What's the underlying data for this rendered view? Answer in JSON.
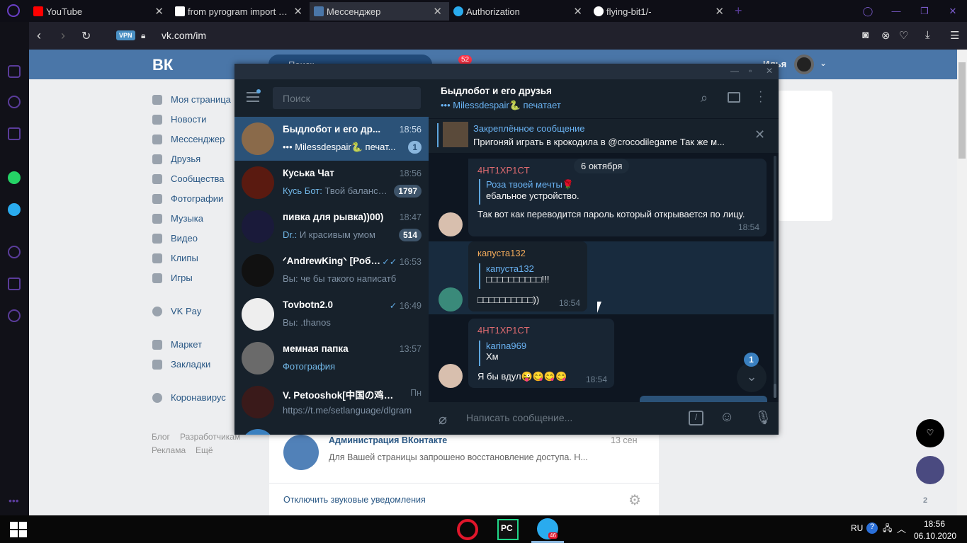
{
  "browser": {
    "tabs": [
      {
        "title": "YouTube",
        "favicon_color": "#ff0000"
      },
      {
        "title": "from pyrogram import Clie",
        "favicon_color": "#ffffff"
      },
      {
        "title": "Мессенджер",
        "favicon_color": "#4a76a8"
      },
      {
        "title": "Authorization",
        "favicon_color": "#2aabee"
      },
      {
        "title": "flying-bit1/-",
        "favicon_color": "#ffffff"
      }
    ],
    "vpn_label": "VPN",
    "url": "vk.com/im"
  },
  "vk": {
    "logo": "ВК",
    "search_placeholder": "Поиск",
    "notif_count": "52",
    "user_name": "Илья",
    "menu": [
      {
        "label": "Моя страница",
        "icon": "home-icon"
      },
      {
        "label": "Новости",
        "icon": "news-icon"
      },
      {
        "label": "Мессенджер",
        "icon": "messenger-icon"
      },
      {
        "label": "Друзья",
        "icon": "friends-icon"
      },
      {
        "label": "Сообщества",
        "icon": "groups-icon"
      },
      {
        "label": "Фотографии",
        "icon": "camera-icon"
      },
      {
        "label": "Музыка",
        "icon": "music-icon"
      },
      {
        "label": "Видео",
        "icon": "video-icon"
      },
      {
        "label": "Клипы",
        "icon": "clips-icon"
      },
      {
        "label": "Игры",
        "icon": "games-icon"
      },
      {
        "label": "VK Pay",
        "icon": "vkpay-icon"
      },
      {
        "label": "Маркет",
        "icon": "market-icon"
      },
      {
        "label": "Закладки",
        "icon": "star-icon"
      },
      {
        "label": "Коронавирус",
        "icon": "virus-icon"
      }
    ],
    "footer": [
      "Блог",
      "Разработчикам",
      "Реклама",
      "Ещё"
    ],
    "admin_dialog": {
      "name": "Администрация ВКонтакте",
      "date": "13 сен",
      "preview": "Для Вашей страницы запрошено восстановление доступа. Н..."
    },
    "disable_sounds": "Отключить звуковые уведомления",
    "online_count": "2"
  },
  "telegram": {
    "search_placeholder": "Поиск",
    "dialogs": [
      {
        "name": "Быдлобот и его др...",
        "time": "18:56",
        "sender": "",
        "preview": "••• Milessdespair🐍 печат...",
        "badge": "1",
        "avatar_color": "#8a6a4a"
      },
      {
        "name": "Куська Чат",
        "time": "18:56",
        "sender": "Кусь Бот:",
        "preview": " Твой баланс: ...",
        "badge": "1797",
        "avatar_color": "#5a1a10"
      },
      {
        "name": "пивка для рывка))00)",
        "time": "18:47",
        "sender": "Dr.:",
        "preview": " И красивым умом",
        "badge": "514",
        "avatar_color": "#1a1a3a"
      },
      {
        "name": "ᐟAndrewKingᐠ [Робо...",
        "time": "16:53",
        "sender": "",
        "preview": "Вы: че бы такого написатб",
        "badge": "",
        "avatar_color": "#111111"
      },
      {
        "name": "Tovbotn2.0",
        "time": "16:49",
        "sender": "",
        "preview": "Вы: .thanos",
        "badge": "",
        "avatar_color": "#f0f0f0"
      },
      {
        "name": "мемная папка",
        "time": "13:57",
        "sender": "",
        "preview": "Фотография",
        "badge": "",
        "avatar_color": "#6a6a6a"
      },
      {
        "name": "V. Petooshok[中国の鸡肉] L...",
        "time": "Пн",
        "sender": "",
        "preview": "https://t.me/setlanguage/dlgram",
        "badge": "",
        "avatar_color": "#3a1a1a"
      }
    ],
    "chat": {
      "title": "Быдлобот и его друзья",
      "status": "••• Milessdespair🐍 печатает",
      "pinned_label": "Закреплённое сообщение",
      "pinned_text": "Пригоняй играть в крокодила в @crocodilegame Так же м...",
      "date_badge": "6 октября",
      "messages": [
        {
          "author": "4HT1XP1CT",
          "reply_author": "Роза твоей мечты🌹",
          "reply_text": "ебальное устройство.",
          "text": "Так вот как переводится пароль который открывается по лицу.",
          "time": "18:54"
        },
        {
          "author": "капуста132",
          "reply_author": "капуста132",
          "reply_text": "□□□□□□□□□□!!!",
          "text": "□□□□□□□□□□))",
          "time": "18:54"
        },
        {
          "author": "4HT1XP1CT",
          "reply_author": "karina969",
          "reply_text": "Хм",
          "text": "Я бы вдул😜😋😋😋",
          "time": "18:54"
        }
      ],
      "unread_count": "1",
      "compose_placeholder": "Написать сообщение..."
    }
  },
  "taskbar": {
    "lang": "RU",
    "time": "18:56",
    "date": "06.10.2020",
    "telegram_badge": "46"
  }
}
